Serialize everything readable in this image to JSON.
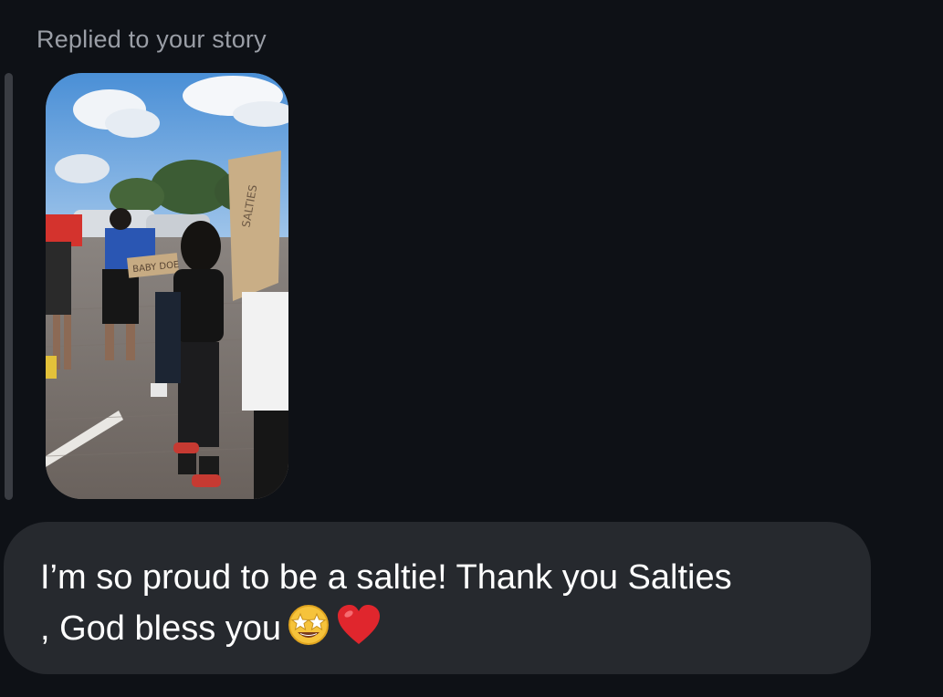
{
  "header": {
    "replied_label": "Replied to your story"
  },
  "story": {
    "sign_text_left": "BABY DOE",
    "sign_text_right": "SALTIES"
  },
  "message": {
    "text": "I’m so proud to be a saltie! Thank you Salties\n, God bless you",
    "emojis": [
      "star-struck-emoji",
      "red-heart-emoji"
    ]
  },
  "colors": {
    "background": "#0e1116",
    "bubble": "#26292e",
    "label": "#9a9ea6",
    "reply_bar": "#3a3d43"
  }
}
